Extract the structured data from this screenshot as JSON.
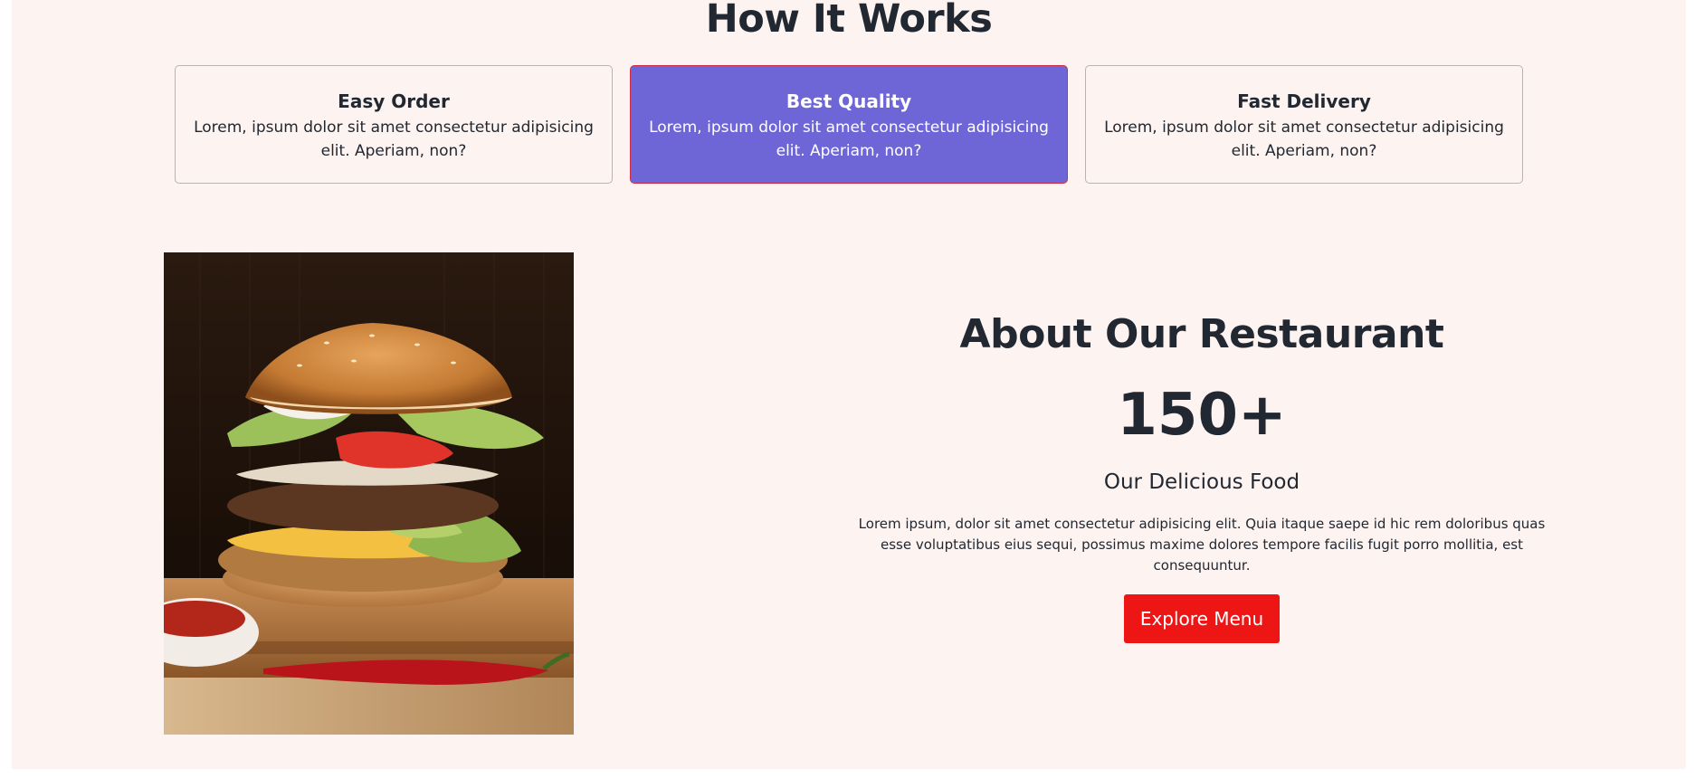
{
  "how_it_works": {
    "title": "How It Works",
    "cards": [
      {
        "title": "Easy Order",
        "text": "Lorem, ipsum dolor sit amet consectetur adipisicing elit. Aperiam, non?",
        "active": false
      },
      {
        "title": "Best Quality",
        "text": "Lorem, ipsum dolor sit amet consectetur adipisicing elit. Aperiam, non?",
        "active": true
      },
      {
        "title": "Fast Delivery",
        "text": "Lorem, ipsum dolor sit amet consectetur adipisicing elit. Aperiam, non?",
        "active": false
      }
    ]
  },
  "about": {
    "title": "About Our Restaurant",
    "count": "150+",
    "subtitle": "Our Delicious Food",
    "text": "Lorem ipsum, dolor sit amet consectetur adipisicing elit. Quia itaque saepe id hic rem doloribus quas esse voluptatibus eius sequi, possimus maxime dolores tempore facilis fugit porro mollitia, est consequuntur.",
    "button_label": "Explore Menu"
  },
  "colors": {
    "page_background": "#fdf3f1",
    "active_card": "#6e66d7",
    "active_card_border": "#d12a44",
    "primary_button": "#ee1515",
    "heading_text": "#222831"
  }
}
